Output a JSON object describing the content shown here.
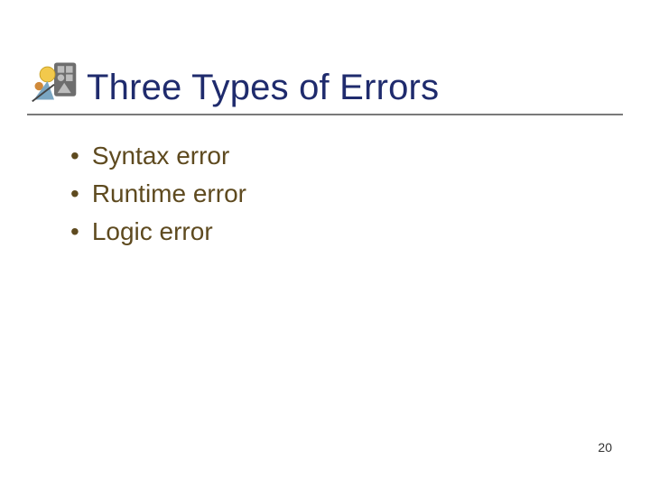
{
  "title": "Three Types of Errors",
  "bullets": [
    "Syntax error",
    "Runtime error",
    "Logic error"
  ],
  "page_number": "20",
  "icon_name": "decorative-clip-art"
}
